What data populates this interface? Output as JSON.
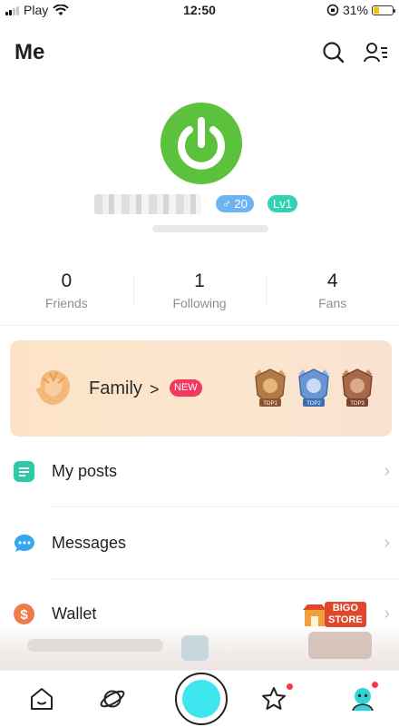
{
  "status_bar": {
    "carrier": "Play",
    "time": "12:50",
    "battery_percent": "31%",
    "battery_level": 0.31
  },
  "header": {
    "title": "Me",
    "search_icon": "search-icon",
    "contacts_icon": "contacts-list-icon"
  },
  "profile": {
    "gender_badge": "♂ 20",
    "level_badge": "Lv1",
    "avatar_icon": "power-icon",
    "colors": {
      "avatar": "#5cc13c",
      "gender": "#6fb4f2",
      "level": "#33d2b2"
    }
  },
  "stats": [
    {
      "value": "0",
      "label": "Friends"
    },
    {
      "value": "1",
      "label": "Following"
    },
    {
      "value": "4",
      "label": "Fans"
    }
  ],
  "family": {
    "title": "Family",
    "new_badge": "NEW",
    "medals": [
      "TOP1",
      "TOP2",
      "TOP3"
    ]
  },
  "menu": [
    {
      "label": "My posts",
      "icon": "document-icon",
      "color": "#2ec9a9"
    },
    {
      "label": "Messages",
      "icon": "chat-bubble-icon",
      "color": "#35a7f0"
    },
    {
      "label": "Wallet",
      "icon": "dollar-coin-icon",
      "color": "#f07a4a"
    }
  ],
  "store_banner": {
    "line1": "BIGO",
    "line2": "STORE"
  },
  "bottom_nav": {
    "items": [
      "home-icon",
      "planet-icon",
      "live-button",
      "star-icon",
      "profile-icon"
    ]
  }
}
